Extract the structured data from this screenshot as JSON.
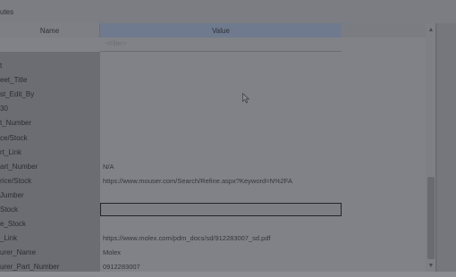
{
  "window": {
    "title": "utes"
  },
  "grid": {
    "columns": {
      "name": "Name",
      "value": "Value"
    },
    "filter_placeholder": "<Filter>",
    "rows": [
      {
        "name": "t",
        "value": ""
      },
      {
        "name": "eet_Title",
        "value": ""
      },
      {
        "name": "st_Edit_By",
        "value": ""
      },
      {
        "name": "30",
        "value": ""
      },
      {
        "name": "t_Number",
        "value": ""
      },
      {
        "name": "ce/Stock",
        "value": ""
      },
      {
        "name": "rt_Link",
        "value": ""
      },
      {
        "name": "art_Number",
        "value": "N/A"
      },
      {
        "name": "rice/Stock",
        "value": "https://www.mouser.com/Search/Refine.aspx?Keyword=N%2FA"
      },
      {
        "name": "Jumber",
        "value": ""
      },
      {
        "name": "Stock",
        "value": ""
      },
      {
        "name": "e_Stock",
        "value": ""
      },
      {
        "name": "_Link",
        "value": "https://www.molex.com/pdm_docs/sd/912283007_sd.pdf"
      },
      {
        "name": "urer_Name",
        "value": "Molex"
      },
      {
        "name": "urer_Part_Number",
        "value": "0912283007"
      }
    ],
    "editing_row_index": 10
  },
  "colors": {
    "header_value_bg": "#6f7a8e",
    "editor_border": "#24252a"
  }
}
